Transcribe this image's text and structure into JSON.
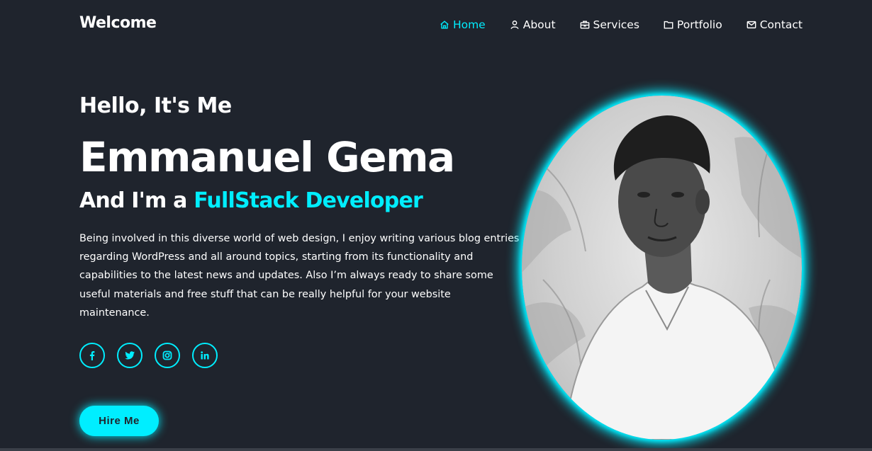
{
  "header": {
    "logo": "Welcome",
    "nav": [
      {
        "label": "Home",
        "icon": "home-icon",
        "active": true
      },
      {
        "label": "About",
        "icon": "user-icon",
        "active": false
      },
      {
        "label": "Services",
        "icon": "briefcase-icon",
        "active": false
      },
      {
        "label": "Portfolio",
        "icon": "folder-icon",
        "active": false
      },
      {
        "label": "Contact",
        "icon": "mail-icon",
        "active": false
      }
    ]
  },
  "home": {
    "greeting": "Hello, It's Me",
    "name": "Emmanuel Gema",
    "role_prefix": "And I'm a ",
    "role_highlight": "FullStack Developer",
    "bio": "Being involved in this diverse world of web design, I enjoy writing various blog entries regarding WordPress and all around topics, starting from its functionality and capabilities to the latest news and updates. Also I’m always ready to share some useful materials and free stuff that can be really helpful for your website maintenance.",
    "socials": [
      {
        "icon": "facebook-icon"
      },
      {
        "icon": "twitter-icon"
      },
      {
        "icon": "instagram-icon"
      },
      {
        "icon": "linkedin-icon"
      }
    ],
    "cta_label": "Hire Me"
  },
  "portrait": {
    "icon": "profile-photo"
  },
  "colors": {
    "background": "#1f242d",
    "accent": "#00eeff",
    "text": "#ffffff"
  }
}
